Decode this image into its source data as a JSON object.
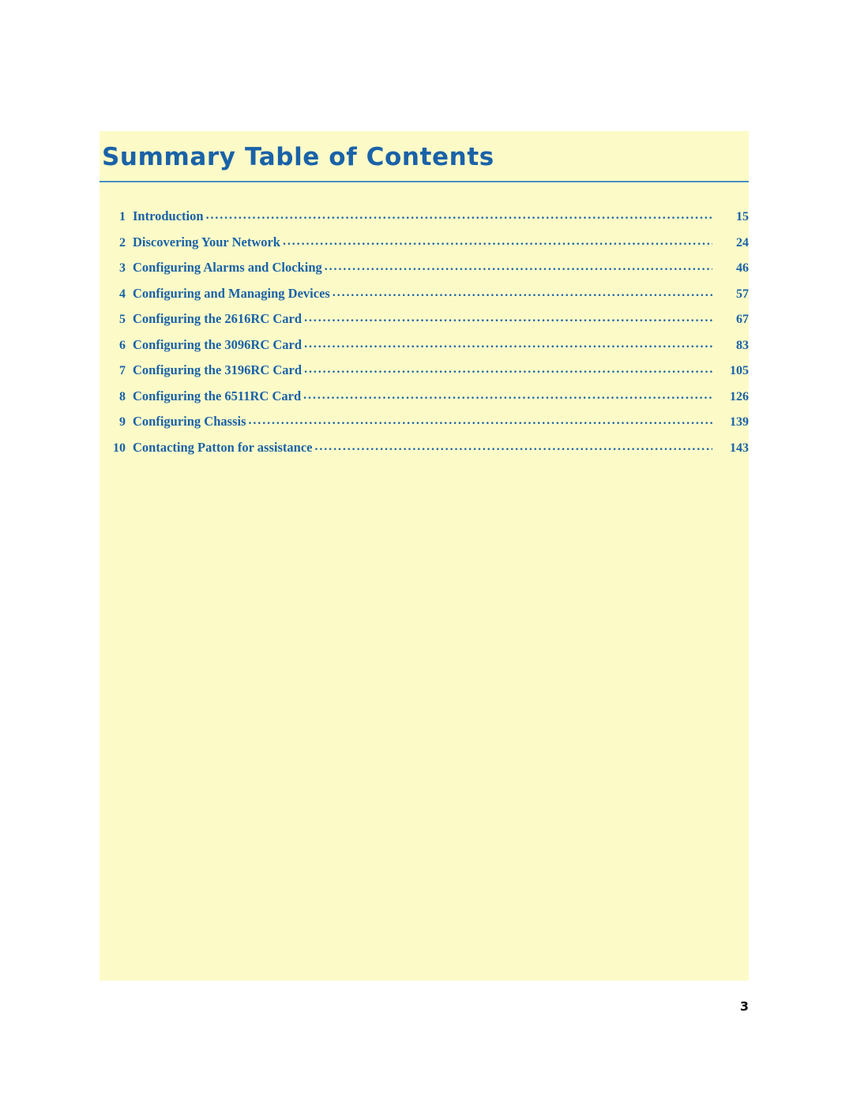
{
  "document": {
    "title": "Summary Table of Contents",
    "page_number": "3",
    "accent_color": "#1a62a8",
    "tint_color": "#fcfbc8",
    "rule_color": "#4a8fc4",
    "entries": [
      {
        "number": "1",
        "label": "Introduction",
        "page": "15"
      },
      {
        "number": "2",
        "label": "Discovering Your Network",
        "page": "24"
      },
      {
        "number": "3",
        "label": "Configuring Alarms and Clocking",
        "page": "46"
      },
      {
        "number": "4",
        "label": "Configuring and Managing Devices",
        "page": "57"
      },
      {
        "number": "5",
        "label": "Configuring the 2616RC Card",
        "page": "67"
      },
      {
        "number": "6",
        "label": "Configuring the 3096RC Card",
        "page": "83"
      },
      {
        "number": "7",
        "label": "Configuring the 3196RC Card",
        "page": "105"
      },
      {
        "number": "8",
        "label": "Configuring the 6511RC Card",
        "page": "126"
      },
      {
        "number": "9",
        "label": "Configuring Chassis",
        "page": "139"
      },
      {
        "number": "10",
        "label": "Contacting Patton for assistance",
        "page": "143"
      }
    ],
    "leader": "........................................................................................................................................................................"
  }
}
